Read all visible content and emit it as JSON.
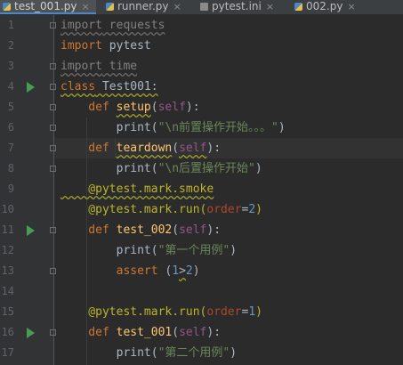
{
  "tabs": [
    {
      "label": "test_001.py",
      "close": "×",
      "active": true
    },
    {
      "label": "runner.py",
      "close": "×"
    },
    {
      "label": "pytest.ini",
      "close": "×"
    },
    {
      "label": "002.py",
      "close": "×"
    }
  ],
  "lines": {
    "n1": "1",
    "n2": "2",
    "n3": "3",
    "n4": "4",
    "n5": "5",
    "n6": "6",
    "n7": "7",
    "n8": "8",
    "n9": "9",
    "n10": "10",
    "n11": "11",
    "n12": "12",
    "n13": "13",
    "n14": "14",
    "n15": "15",
    "n16": "16",
    "n17": "17",
    "l1a": "import",
    "l1b": " requests",
    "l2a": "import",
    "l2b": " pytest",
    "l3a": "import",
    "l3b": " time",
    "l4a": "class",
    "l4b": " Test001:",
    "l5a": "    def ",
    "l5b": "setup",
    "l5c": "(",
    "l5d": "self",
    "l5e": "):",
    "l6a": "        print(",
    "l6b": "\"\\n前置操作开始。。。\"",
    "l6c": ")",
    "l7a": "    def ",
    "l7b": "teardown",
    "l7c": "(",
    "l7d": "self",
    "l7e": "):",
    "l8a": "        print(",
    "l8b": "\"\\n后置操作开始\"",
    "l8c": ")",
    "l9a": "    @pytest.mark.smoke",
    "l10a": "    @pytest.mark.run(",
    "l10b": "order",
    "l10c": "=",
    "l10d": "2",
    "l10e": ")",
    "l11a": "    def ",
    "l11b": "test_002",
    "l11c": "(",
    "l11d": "self",
    "l11e": "):",
    "l12a": "        print(",
    "l12b": "\"第一个用例\"",
    "l12c": ")",
    "l13a": "        assert ",
    "l13b": "(",
    "l13c": "1",
    "l13d": ">",
    "l13e": "2",
    "l13f": ")",
    "l15a": "    @pytest.mark.run(",
    "l15b": "order",
    "l15c": "=",
    "l15d": "1",
    "l15e": ")",
    "l16a": "    def ",
    "l16b": "test_001",
    "l16c": "(",
    "l16d": "self",
    "l16e": "):",
    "l17a": "        print(",
    "l17b": "\"第二个用例\"",
    "l17c": ")"
  },
  "colors": {
    "background": "#2b2b2b",
    "keyword": "#cc7832",
    "string": "#6a8759",
    "number": "#6897bb",
    "decorator": "#bbb529",
    "self": "#94558d",
    "run_icon": "#499c54"
  }
}
